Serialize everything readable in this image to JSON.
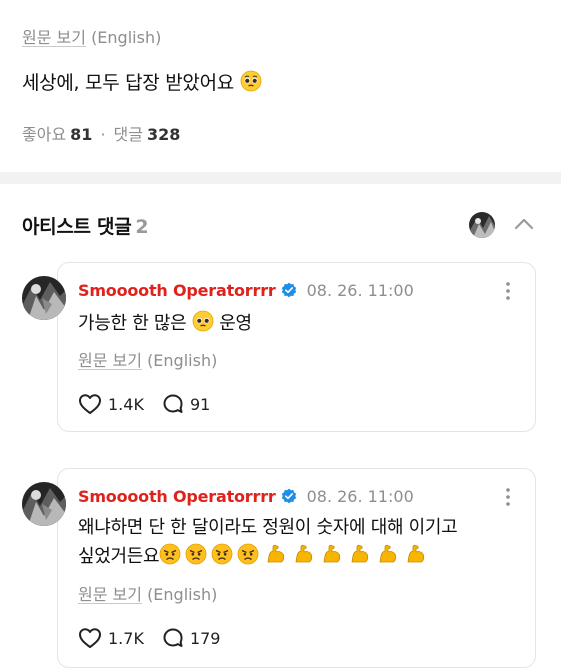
{
  "post": {
    "translate_ko": "원문 보기",
    "translate_lang": "(English)",
    "text": "세상에, 모두 답장 받았어요",
    "stats": {
      "likes_label": "좋아요",
      "likes_count": "81",
      "separator": "·",
      "comments_label": "댓글",
      "comments_count": "328"
    }
  },
  "artist_comments": {
    "title": "아티스트 댓글",
    "count": "2",
    "collapse_icon": "chevron-up-icon"
  },
  "comments": [
    {
      "author": "Smooooth Operatorrrr",
      "verified": true,
      "time": "08. 26. 11:00",
      "text_before": "가능한 한 많은",
      "text_after": "운영",
      "emojis": [
        "pleading-face"
      ],
      "translate_ko": "원문 보기",
      "translate_lang": "(English)",
      "likes": "1.4K",
      "replies": "91"
    },
    {
      "author": "Smooooth Operatorrrr",
      "verified": true,
      "time": "08. 26. 11:00",
      "text_line1": "왜냐하면 단 한 달이라도 정원이 숫자에 대해 이기고",
      "text_line2": "싶었거든요",
      "emojis": [
        "angry-face",
        "angry-face",
        "angry-face",
        "angry-face",
        "flexed-biceps",
        "flexed-biceps",
        "flexed-biceps",
        "flexed-biceps",
        "flexed-biceps",
        "flexed-biceps"
      ],
      "translate_ko": "원문 보기",
      "translate_lang": "(English)",
      "likes": "1.7K",
      "replies": "179"
    }
  ],
  "colors": {
    "author": "#e0221c",
    "verified": "#1f8ee8",
    "muted": "#8e8e8e",
    "divider": "#f2f2f3"
  }
}
